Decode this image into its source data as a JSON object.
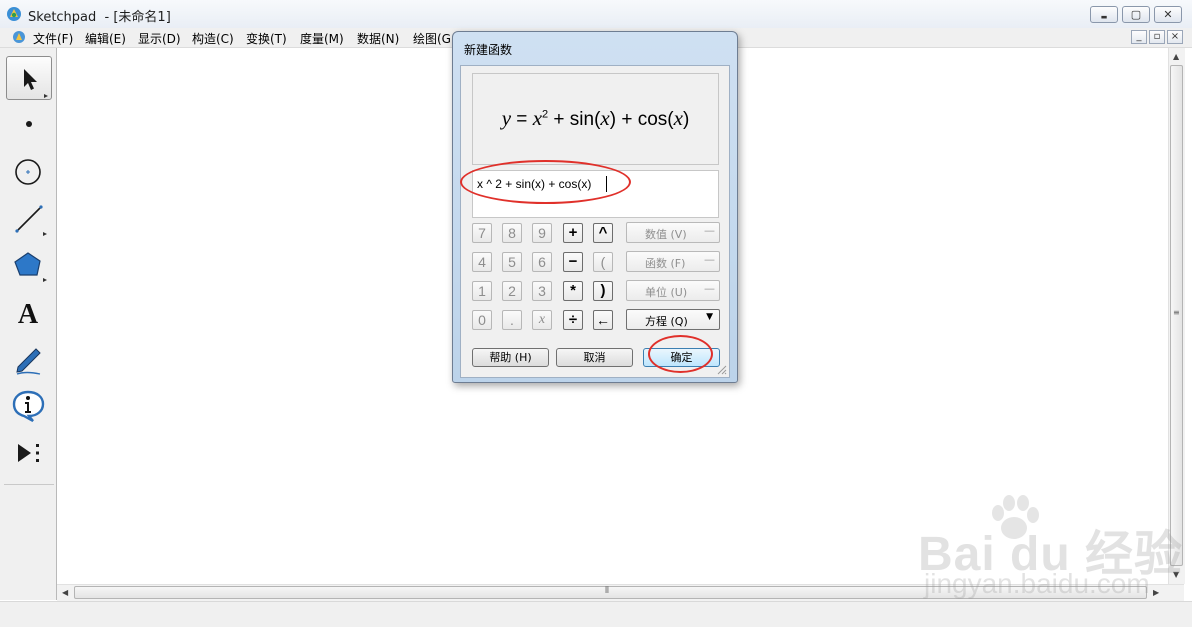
{
  "window": {
    "title": "Sketchpad  - [未命名1]",
    "buttons": {
      "minimize": "▬",
      "maximize": "▢",
      "close": "✕"
    }
  },
  "menubar": {
    "items": [
      "文件(F)",
      "编辑(E)",
      "显示(D)",
      "构造(C)",
      "变换(T)",
      "度量(M)",
      "数据(N)",
      "绘图(G"
    ],
    "mdi_buttons": [
      "_",
      "▫",
      "×"
    ]
  },
  "toolbox": {
    "tools": [
      {
        "name": "arrow-tool",
        "selected": true
      },
      {
        "name": "point-tool",
        "selected": false
      },
      {
        "name": "compass-tool",
        "selected": false
      },
      {
        "name": "straightedge-tool",
        "selected": false
      },
      {
        "name": "polygon-tool",
        "selected": false
      },
      {
        "name": "text-tool",
        "glyph": "A",
        "selected": false
      },
      {
        "name": "marker-tool",
        "selected": false
      },
      {
        "name": "information-tool",
        "selected": false
      },
      {
        "name": "custom-tool",
        "selected": false
      }
    ]
  },
  "dialog": {
    "title": "新建函数",
    "preview": {
      "lhs": "y",
      "eq": " = ",
      "var": "x",
      "exp": "2",
      "mid1": " + sin(",
      "mid2": ") + cos(",
      "end": ")"
    },
    "entry": {
      "value": "x ^ 2 + sin(x) + cos(x)"
    },
    "keypad": [
      [
        "7",
        "8",
        "9",
        "+",
        "^"
      ],
      [
        "4",
        "5",
        "6",
        "−",
        "("
      ],
      [
        "1",
        "2",
        "3",
        "*",
        ")"
      ],
      [
        "0",
        ".",
        "x",
        "÷",
        "←"
      ]
    ],
    "menus": [
      {
        "label": "数值 (V)",
        "arrow": "—",
        "enabled": false
      },
      {
        "label": "函数 (F)",
        "arrow": "—",
        "enabled": false
      },
      {
        "label": "单位 (U)",
        "arrow": "—",
        "enabled": false
      },
      {
        "label": "方程 (Q)",
        "arrow": "▼",
        "enabled": true
      }
    ],
    "buttons": {
      "help": "帮助 (H)",
      "cancel": "取消",
      "ok": "确定"
    }
  },
  "watermark": {
    "text": "Bai du 经验",
    "url": "jingyan.baidu.com"
  },
  "colors": {
    "annotation": "#e0302a",
    "dialog_frame": "#bcd3ea",
    "accent": "#3c7fb1"
  }
}
